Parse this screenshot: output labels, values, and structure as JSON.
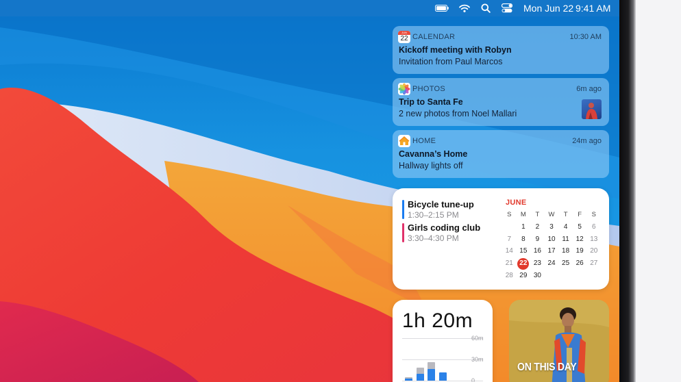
{
  "menubar": {
    "icons": [
      "battery-icon",
      "wifi-icon",
      "search-icon",
      "control-center-icon"
    ],
    "date": "Mon Jun 22",
    "time": "9:41 AM"
  },
  "notifications": [
    {
      "app": "CALENDAR",
      "icon_text": "22",
      "icon_month": "JUN",
      "time": "10:30 AM",
      "title": "Kickoff meeting with Robyn",
      "body": "Invitation from Paul Marcos"
    },
    {
      "app": "PHOTOS",
      "time": "6m ago",
      "title": "Trip to Santa Fe",
      "body": "2 new photos from Noel Mallari"
    },
    {
      "app": "HOME",
      "time": "24m ago",
      "title": "Cavanna’s Home",
      "body": "Hallway lights off"
    }
  ],
  "calendar_widget": {
    "events": [
      {
        "title": "Bicycle tune-up",
        "time": "1:30–2:15 PM",
        "color": "#1a7cf0"
      },
      {
        "title": "Girls coding club",
        "time": "3:30–4:30 PM",
        "color": "#e0326a"
      }
    ],
    "month": "JUNE",
    "weekdays": [
      "S",
      "M",
      "T",
      "W",
      "T",
      "F",
      "S"
    ],
    "weeks": [
      [
        "",
        "1",
        "2",
        "3",
        "4",
        "5",
        "6"
      ],
      [
        "7",
        "8",
        "9",
        "10",
        "11",
        "12",
        "13"
      ],
      [
        "14",
        "15",
        "16",
        "17",
        "18",
        "19",
        "20"
      ],
      [
        "21",
        "22",
        "23",
        "24",
        "25",
        "26",
        "27"
      ],
      [
        "28",
        "29",
        "30",
        "",
        "",
        "",
        ""
      ]
    ],
    "today": "22"
  },
  "screen_time_widget": {
    "total": "1h 20m",
    "axis_labels": [
      "60m",
      "30m",
      "0"
    ],
    "bars": [
      {
        "minutes_blue": 3,
        "minutes_light": 5
      },
      {
        "minutes_blue": 10,
        "minutes_light": 18
      },
      {
        "minutes_blue": 16,
        "minutes_light": 26
      },
      {
        "minutes_blue": 12,
        "minutes_light": 0
      }
    ]
  },
  "photo_widget": {
    "label": "ON THIS DAY"
  },
  "colors": {
    "accent_red": "#e1392c",
    "calendar_blue": "#1a7cf0",
    "coding_pink": "#e0326a"
  }
}
